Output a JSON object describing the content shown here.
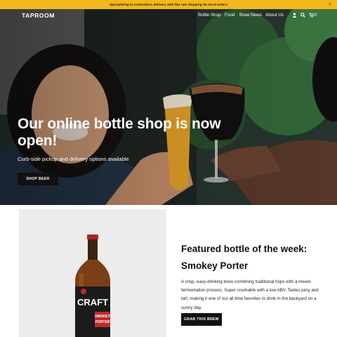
{
  "announcement": {
    "text": "Specializing in contactless delivery with flat rate shipping for local orders",
    "close_icon": "close-icon"
  },
  "header": {
    "logo": "TAPROOM",
    "nav": [
      "Bottle Shop",
      "Food",
      "Brew News",
      "About Us"
    ],
    "icons": [
      "user-icon",
      "search-icon",
      "cart-icon"
    ],
    "cart_count": "0"
  },
  "hero": {
    "title": "Our online bottle shop is now open!",
    "subtitle": "Curb-side pickup and delivery options available",
    "button": "SHOP BEER"
  },
  "featured": {
    "heading": "Featured bottle of the week:",
    "name": "Smokey Porter",
    "description": "A crisp, easy-drinking brew combining traditional hops with a mixed-fermentation process. Super crushable with a low ABV. Tastes juicy and tart, making it one of our all time favorites to drink in the backyard on a sunny day.",
    "button": "GRAB THIS BREW",
    "label_text": [
      "CRAFT",
      "SMOKEY",
      "PORTER"
    ]
  },
  "colors": {
    "announcement_bg": "#f2b81c",
    "button_bg": "#111111",
    "panel_bg": "#ececec"
  }
}
